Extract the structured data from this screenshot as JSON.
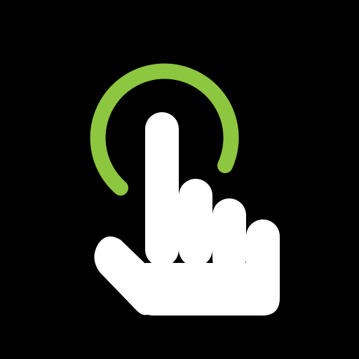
{
  "icon": {
    "name": "tap-gesture-icon",
    "background_color": "#000000",
    "ripple_color": "#8DC63F",
    "hand_color": "#FFFFFF"
  }
}
